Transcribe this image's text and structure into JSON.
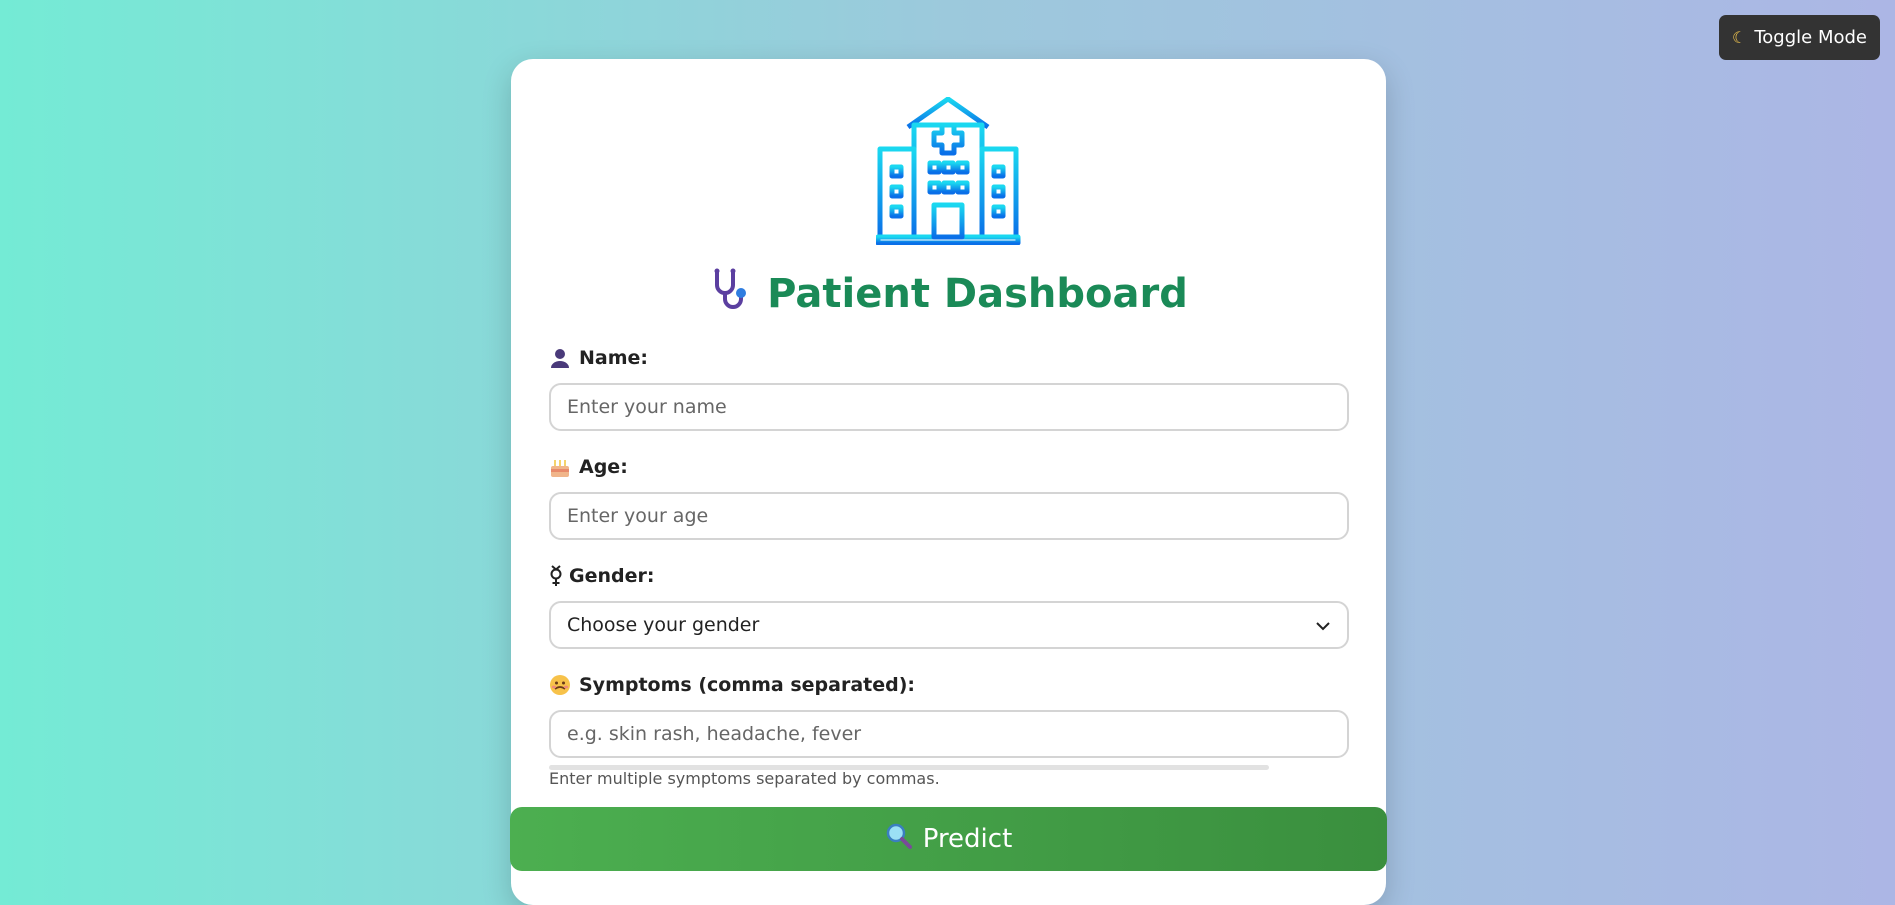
{
  "toggle": {
    "label": "Toggle Mode",
    "icon": "moon-icon"
  },
  "header": {
    "title": "Patient Dashboard",
    "logo_icon": "hospital-icon",
    "title_icon": "stethoscope-icon"
  },
  "form": {
    "name": {
      "label": "Name:",
      "icon": "person-icon",
      "placeholder": "Enter your name",
      "value": ""
    },
    "age": {
      "label": "Age:",
      "icon": "cake-icon",
      "placeholder": "Enter your age",
      "value": ""
    },
    "gender": {
      "label": "Gender:",
      "icon": "gender-icon",
      "selected": "Choose your gender"
    },
    "symptoms": {
      "label": "Symptoms (comma separated):",
      "icon": "sick-face-icon",
      "placeholder": "e.g. skin rash, headache, fever",
      "value": "",
      "hint": "Enter multiple symptoms separated by commas."
    }
  },
  "predict": {
    "label": "Predict",
    "icon": "magnifier-icon"
  },
  "colors": {
    "title": "#1a8a57",
    "predict_button": "#4caf50",
    "toggle_button": "#333333",
    "logo": "#00a2e8"
  }
}
